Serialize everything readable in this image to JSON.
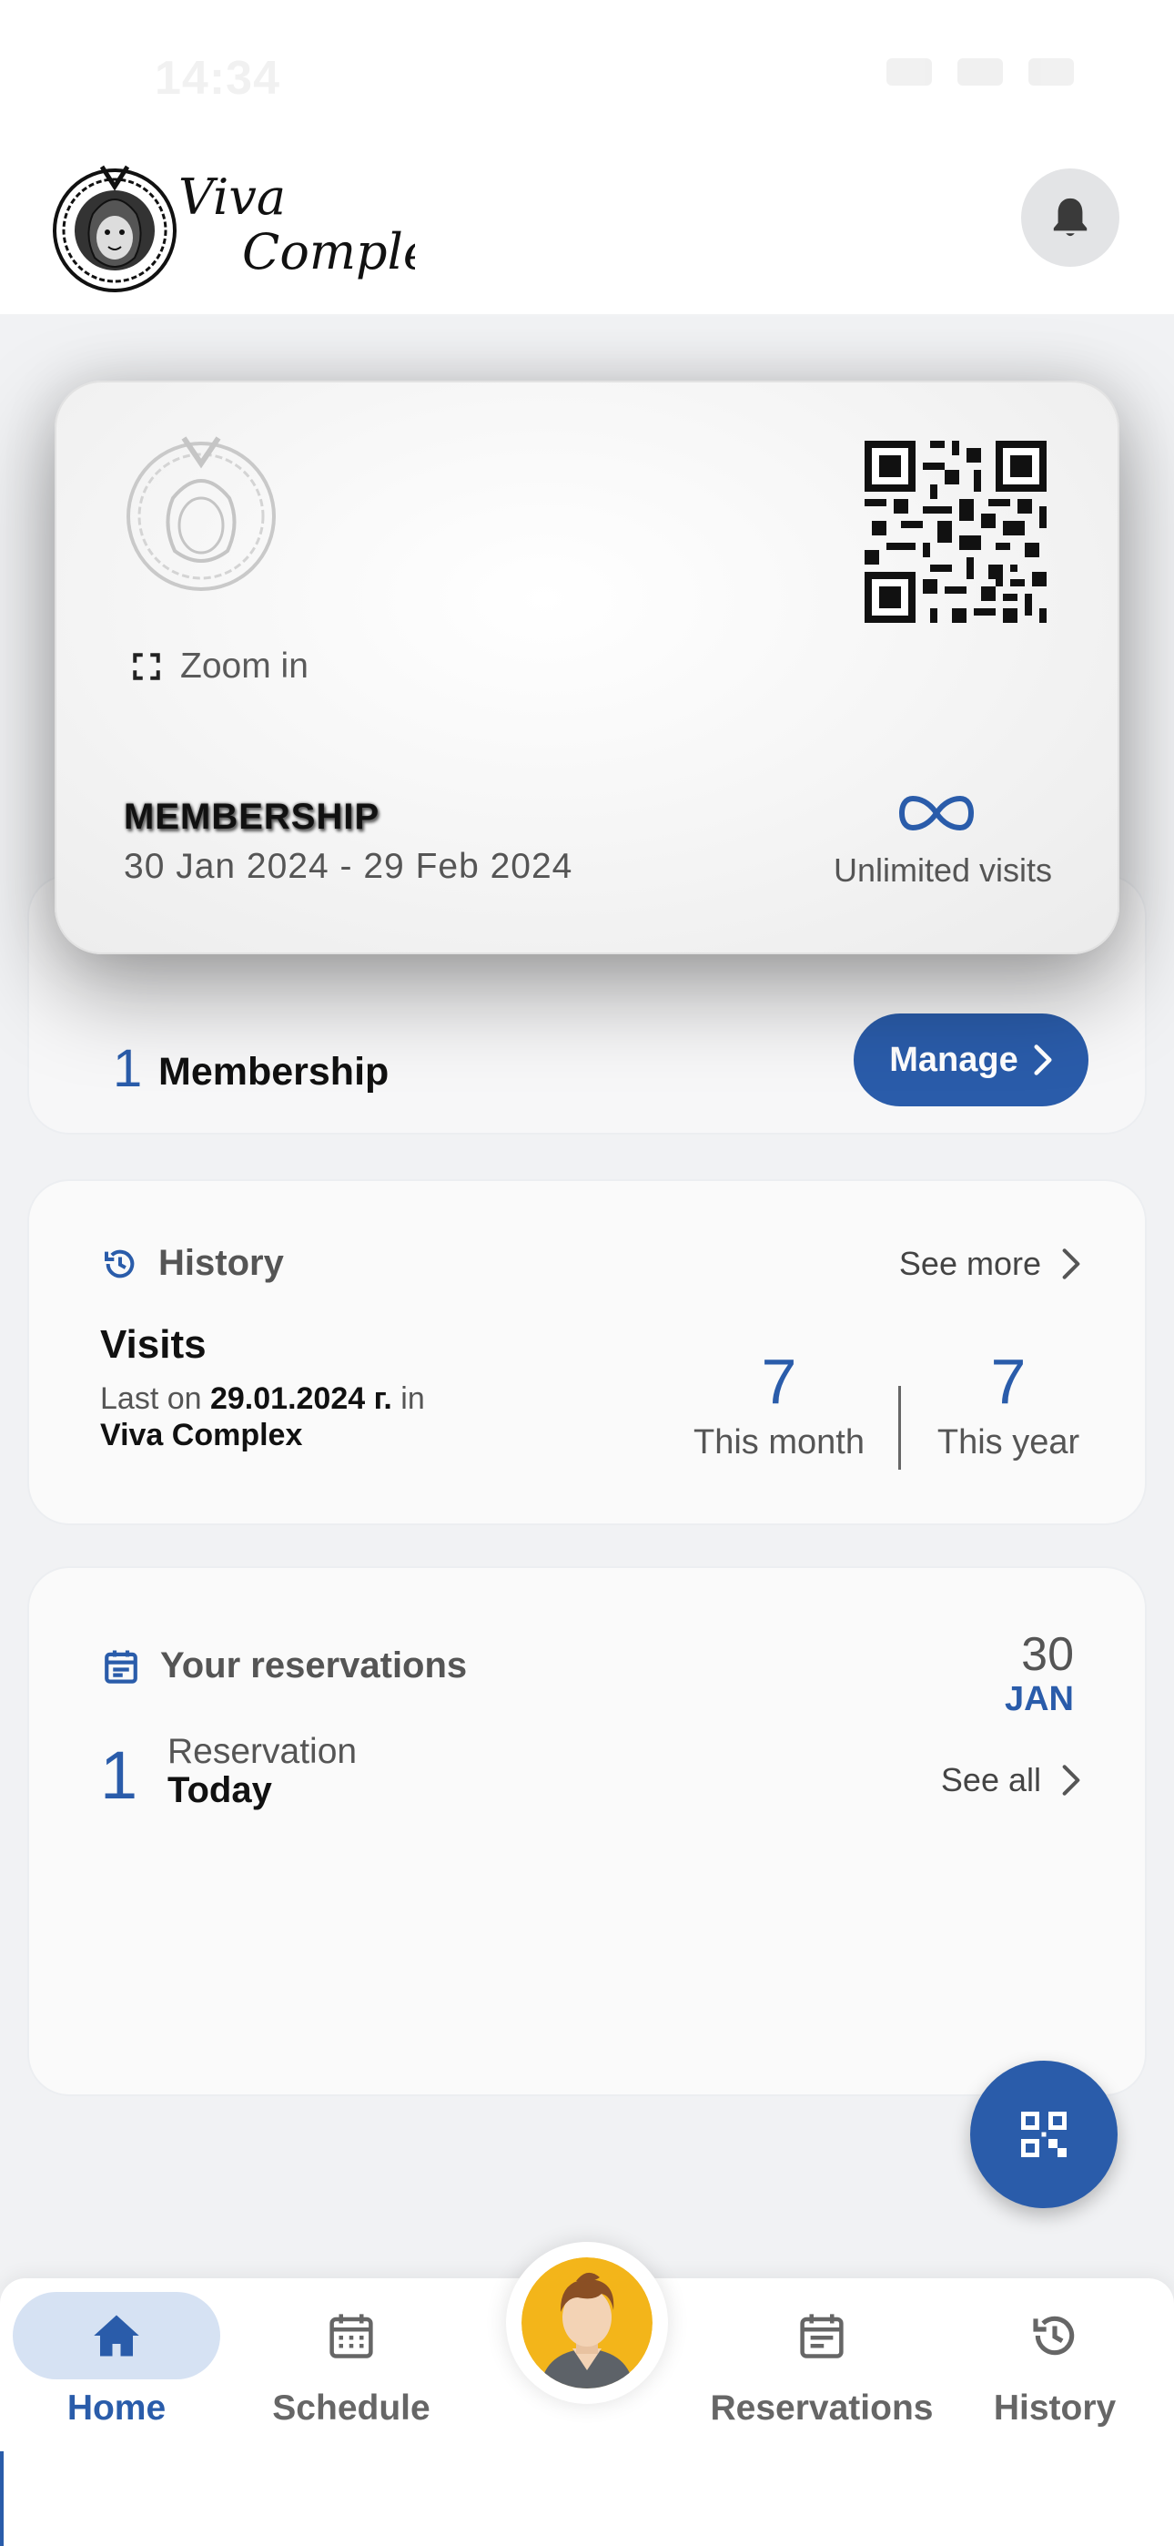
{
  "status_bar": {
    "time": "14:34"
  },
  "header": {
    "brand": "Viva Complex",
    "brand_line1": "Viva",
    "brand_line2": "Complex",
    "notification_icon": "bell-icon"
  },
  "membership_card": {
    "zoom_label": "Zoom in",
    "title": "MEMBERSHIP",
    "dates": "30 Jan 2024 - 29 Feb 2024",
    "visits_label": "Unlimited visits"
  },
  "membership_summary": {
    "count": "1",
    "label": "Membership",
    "manage_label": "Manage"
  },
  "history": {
    "title": "History",
    "see_more": "See more",
    "visits_title": "Visits",
    "last_on_prefix": "Last on",
    "last_date": "29.01.2024 г.",
    "last_in": "in",
    "last_place": "Viva Complex",
    "this_month_value": "7",
    "this_month_label": "This month",
    "this_year_value": "7",
    "this_year_label": "This year"
  },
  "reservations": {
    "title": "Your reservations",
    "date_day": "30",
    "date_month": "JAN",
    "count": "1",
    "label": "Reservation",
    "when": "Today",
    "see_all": "See all"
  },
  "bottom_nav": {
    "items": [
      {
        "label": "Home",
        "icon": "home-icon",
        "active": true
      },
      {
        "label": "Schedule",
        "icon": "calendar-icon",
        "active": false
      },
      {
        "label": "Reservations",
        "icon": "reservations-icon",
        "active": false
      },
      {
        "label": "History",
        "icon": "history-icon",
        "active": false
      }
    ]
  },
  "colors": {
    "primary": "#2a5caa",
    "background": "#f1f2f4",
    "nav_active_bg": "#d6e2f3"
  }
}
